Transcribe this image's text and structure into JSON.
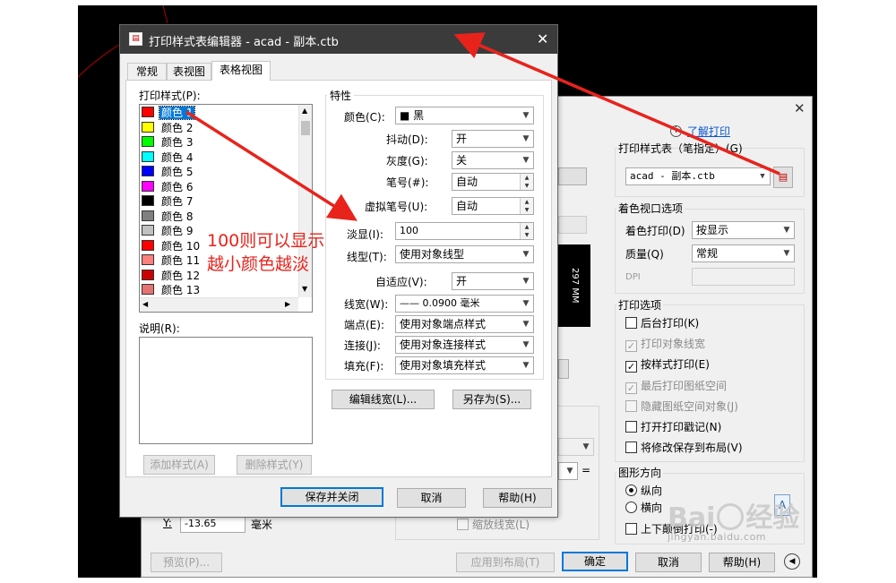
{
  "ctb_editor": {
    "title": "打印样式表编辑器 - acad - 副本.ctb",
    "close_icon": "close-icon",
    "tabs": [
      "常规",
      "表视图",
      "表格视图"
    ],
    "active_tab": 2,
    "styles_label": "打印样式(P):",
    "styles": [
      {
        "name": "颜色",
        "num": "1",
        "color": "#ff0000"
      },
      {
        "name": "颜色",
        "num": "2",
        "color": "#ffff00"
      },
      {
        "name": "颜色",
        "num": "3",
        "color": "#00ff00"
      },
      {
        "name": "颜色",
        "num": "4",
        "color": "#00ffff"
      },
      {
        "name": "颜色",
        "num": "5",
        "color": "#0000ff"
      },
      {
        "name": "颜色",
        "num": "6",
        "color": "#ff00ff"
      },
      {
        "name": "颜色",
        "num": "7",
        "color": "#000000"
      },
      {
        "name": "颜色",
        "num": "8",
        "color": "#808080"
      },
      {
        "name": "颜色",
        "num": "9",
        "color": "#c0c0c0"
      },
      {
        "name": "颜色",
        "num": "10",
        "color": "#ff0000"
      },
      {
        "name": "颜色",
        "num": "11",
        "color": "#ff7f7f"
      },
      {
        "name": "颜色",
        "num": "12",
        "color": "#cc0000"
      },
      {
        "name": "颜色",
        "num": "13",
        "color": "#e57373"
      }
    ],
    "desc_label": "说明(R):",
    "add_style": "添加样式(A)",
    "del_style": "删除样式(Y)",
    "props_title": "特性",
    "color_label": "颜色(C):",
    "color_value": "■ 黑",
    "dither_label": "抖动(D):",
    "dither_value": "开",
    "gray_label": "灰度(G):",
    "gray_value": "关",
    "pen_label": "笔号(#):",
    "pen_value": "自动",
    "vpen_label": "虚拟笔号(U):",
    "vpen_value": "自动",
    "screen_label": "淡显(I):",
    "screen_value": "100",
    "ltype_label": "线型(T):",
    "ltype_value": "使用对象线型",
    "adapt_label": "自适应(V):",
    "adapt_value": "开",
    "lweight_label": "线宽(W):",
    "lweight_value": "—— 0.0900 毫米",
    "endcap_label": "端点(E):",
    "endcap_value": "使用对象端点样式",
    "join_label": "连接(J):",
    "join_value": "使用对象连接样式",
    "fill_label": "填充(F):",
    "fill_value": "使用对象填充样式",
    "edit_lw": "编辑线宽(L)...",
    "save_as": "另存为(S)...",
    "save_close": "保存并关闭",
    "cancel": "取消",
    "help": "帮助(H)"
  },
  "annotation": {
    "line1": "100则可以显示",
    "line2": "越小颜色越淡"
  },
  "plot_dialog": {
    "learn_link": "了解打印",
    "info_icon": "info-icon",
    "ctb_group": "打印样式表（笔指定）(G)",
    "ctb_value": "acad - 副本.ctb",
    "edit_icon": "edit-table-icon",
    "shade_group": "着色视口选项",
    "shade_label": "着色打印(D)",
    "shade_value": "按显示",
    "quality_label": "质量(Q)",
    "quality_value": "常规",
    "dpi_label": "DPI",
    "opts_group": "打印选项",
    "opts": [
      {
        "label": "后台打印(K)",
        "checked": false,
        "disabled": false
      },
      {
        "label": "打印对象线宽",
        "checked": true,
        "disabled": true
      },
      {
        "label": "按样式打印(E)",
        "checked": true,
        "disabled": false
      },
      {
        "label": "最后打印图纸空间",
        "checked": true,
        "disabled": true
      },
      {
        "label": "隐藏图纸空间对象(J)",
        "checked": false,
        "disabled": true
      },
      {
        "label": "打开打印戳记(N)",
        "checked": false,
        "disabled": false
      },
      {
        "label": "将修改保存到布局(V)",
        "checked": false,
        "disabled": false
      }
    ],
    "orient_group": "图形方向",
    "portrait": "纵向",
    "landscape": "横向",
    "upside": "上下颠倒打印(-)",
    "preview_dim": "297 MM",
    "y_label": "Y:",
    "y_value": "-13.65",
    "y_unit": "毫米",
    "scale_lw": "缩放线宽(L)",
    "preview_btn": "预览(P)...",
    "apply_btn": "应用到布局(T)",
    "ok_btn": "确定",
    "cancel_btn": "取消",
    "help_btn": "帮助(H)",
    "equals": "="
  },
  "watermark": {
    "brand": "Bai",
    "brand2": "经验",
    "url": "jingyan.baidu.com"
  }
}
